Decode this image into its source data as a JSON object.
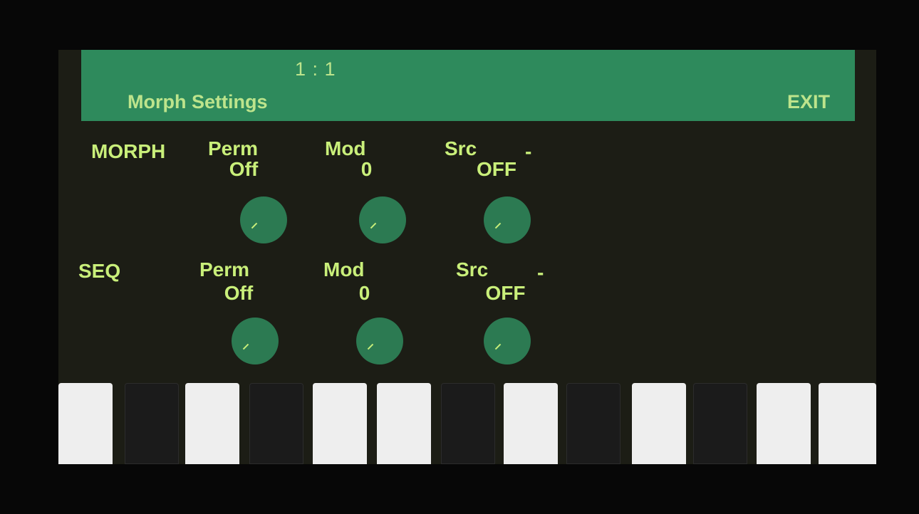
{
  "header": {
    "position": "1 : 1",
    "title": "Morph Settings",
    "exit_label": "EXIT"
  },
  "rows": [
    {
      "label": "MORPH",
      "params": [
        {
          "name": "Perm",
          "value": "Off"
        },
        {
          "name": "Mod",
          "value": "0"
        },
        {
          "name": "Src",
          "value": "OFF",
          "suffix": "-"
        }
      ]
    },
    {
      "label": "SEQ",
      "params": [
        {
          "name": "Perm",
          "value": "Off"
        },
        {
          "name": "Mod",
          "value": "0"
        },
        {
          "name": "Src",
          "value": "OFF",
          "suffix": "-"
        }
      ]
    }
  ],
  "keyboard": {
    "keys": [
      "white",
      "dark",
      "white",
      "dark",
      "white",
      "white",
      "dark",
      "white",
      "dark",
      "white",
      "dark",
      "white",
      "white"
    ]
  },
  "colors": {
    "header_bg": "#2e8a5c",
    "text": "#c9ef7a",
    "knob": "#2c7a52",
    "screen_bg": "#1c1d15"
  }
}
